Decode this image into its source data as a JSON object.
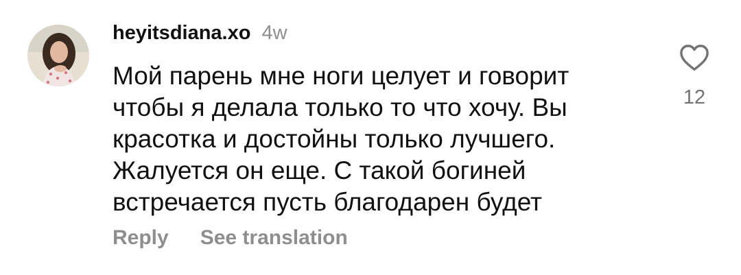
{
  "comment": {
    "username": "heyitsdiana.xo",
    "timestamp": "4w",
    "text_lines": [
      "Мой парень мне ноги целует и говорит",
      "чтобы я делала только то что хочу. Вы",
      "красотка и достойны только лучшего.",
      "Жалуется он еще. С такой богиней",
      "встречается пусть благодарен будет"
    ],
    "likes": "12",
    "actions": {
      "reply": "Reply",
      "see_translation": "See translation"
    }
  },
  "icons": {
    "like": "heart-outline-icon",
    "avatar": "profile-photo"
  },
  "colors": {
    "text": "#111111",
    "secondary": "#8e8e8e",
    "background": "#ffffff"
  }
}
